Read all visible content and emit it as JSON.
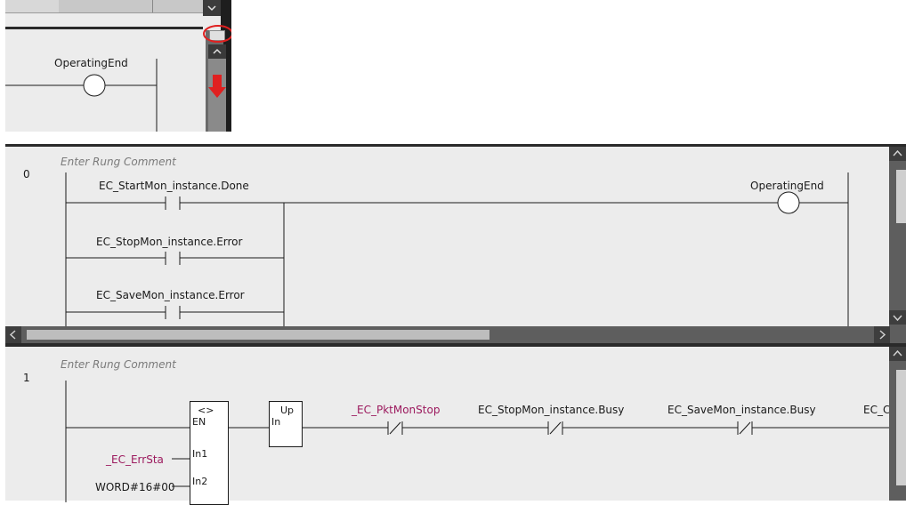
{
  "inset": {
    "coil_label": "OperatingEnd"
  },
  "rung0": {
    "number": "0",
    "comment_placeholder": "Enter Rung Comment",
    "contacts": [
      "EC_StartMon_instance.Done",
      "EC_StopMon_instance.Error",
      "EC_SaveMon_instance.Error"
    ],
    "coil_label": "OperatingEnd"
  },
  "rung1": {
    "number": "1",
    "comment_placeholder": "Enter Rung Comment",
    "compare_block": {
      "title": "<>",
      "pin_en": "EN",
      "pin_in1": "In1",
      "pin_in2": "In2",
      "input1": "_EC_ErrSta",
      "input2": "WORD#16#00"
    },
    "up_block": {
      "title": "Up",
      "pin_in": "In"
    },
    "contacts": [
      "_EC_PktMonStop",
      "EC_StopMon_instance.Busy",
      "EC_SaveMon_instance.Busy",
      "EC_Co"
    ]
  },
  "colors": {
    "panel_bg": "#ececec",
    "variable_magenta": "#9c1a5e",
    "scrollbar_bg": "#5e5e5e",
    "highlight_red": "#e02020"
  }
}
